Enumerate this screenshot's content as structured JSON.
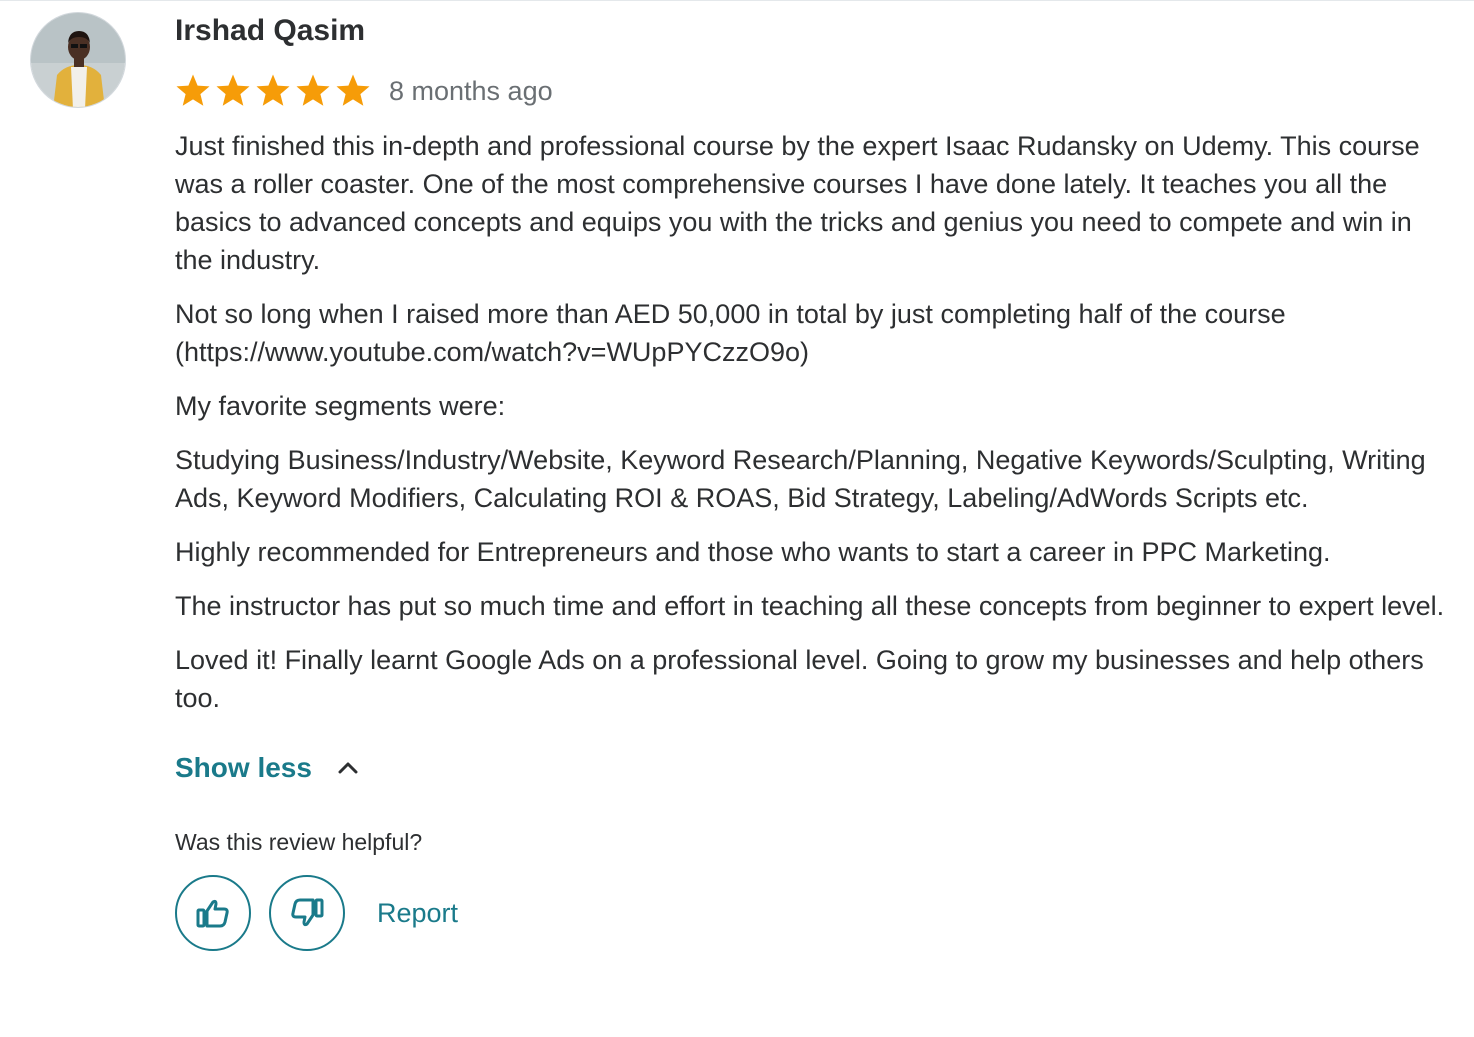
{
  "review": {
    "reviewer_name": "Irshad Qasim",
    "rating": 5,
    "rating_max": 5,
    "time_ago": "8 months ago",
    "star_color": "#f69c08",
    "paragraphs": [
      "Just finished this in-depth and professional course by the expert Isaac Rudansky on Udemy. This course was a roller coaster. One of the most comprehensive courses I have done lately. It teaches you all the basics to advanced concepts and equips you with the tricks and genius you need to compete and win in the industry.",
      "Not so long when I raised more than AED 50,000 in total by just completing half of the course (https://www.youtube.com/watch?v=WUpPYCzzO9o)",
      "My favorite segments were:",
      "Studying Business/Industry/Website, Keyword Research/Planning, Negative Keywords/Sculpting, Writing Ads, Keyword Modifiers, Calculating ROI & ROAS, Bid Strategy, Labeling/AdWords Scripts etc.",
      "Highly recommended for Entrepreneurs and those who wants to start a career in PPC Marketing.",
      "The instructor has put so much time and effort in teaching all these concepts from beginner to expert level.",
      "Loved it! Finally learnt Google Ads on a professional level. Going to grow my businesses and help others too."
    ],
    "show_less_label": "Show less",
    "helpful_question": "Was this review helpful?",
    "report_label": "Report",
    "accent_color": "#1a7a8a"
  }
}
